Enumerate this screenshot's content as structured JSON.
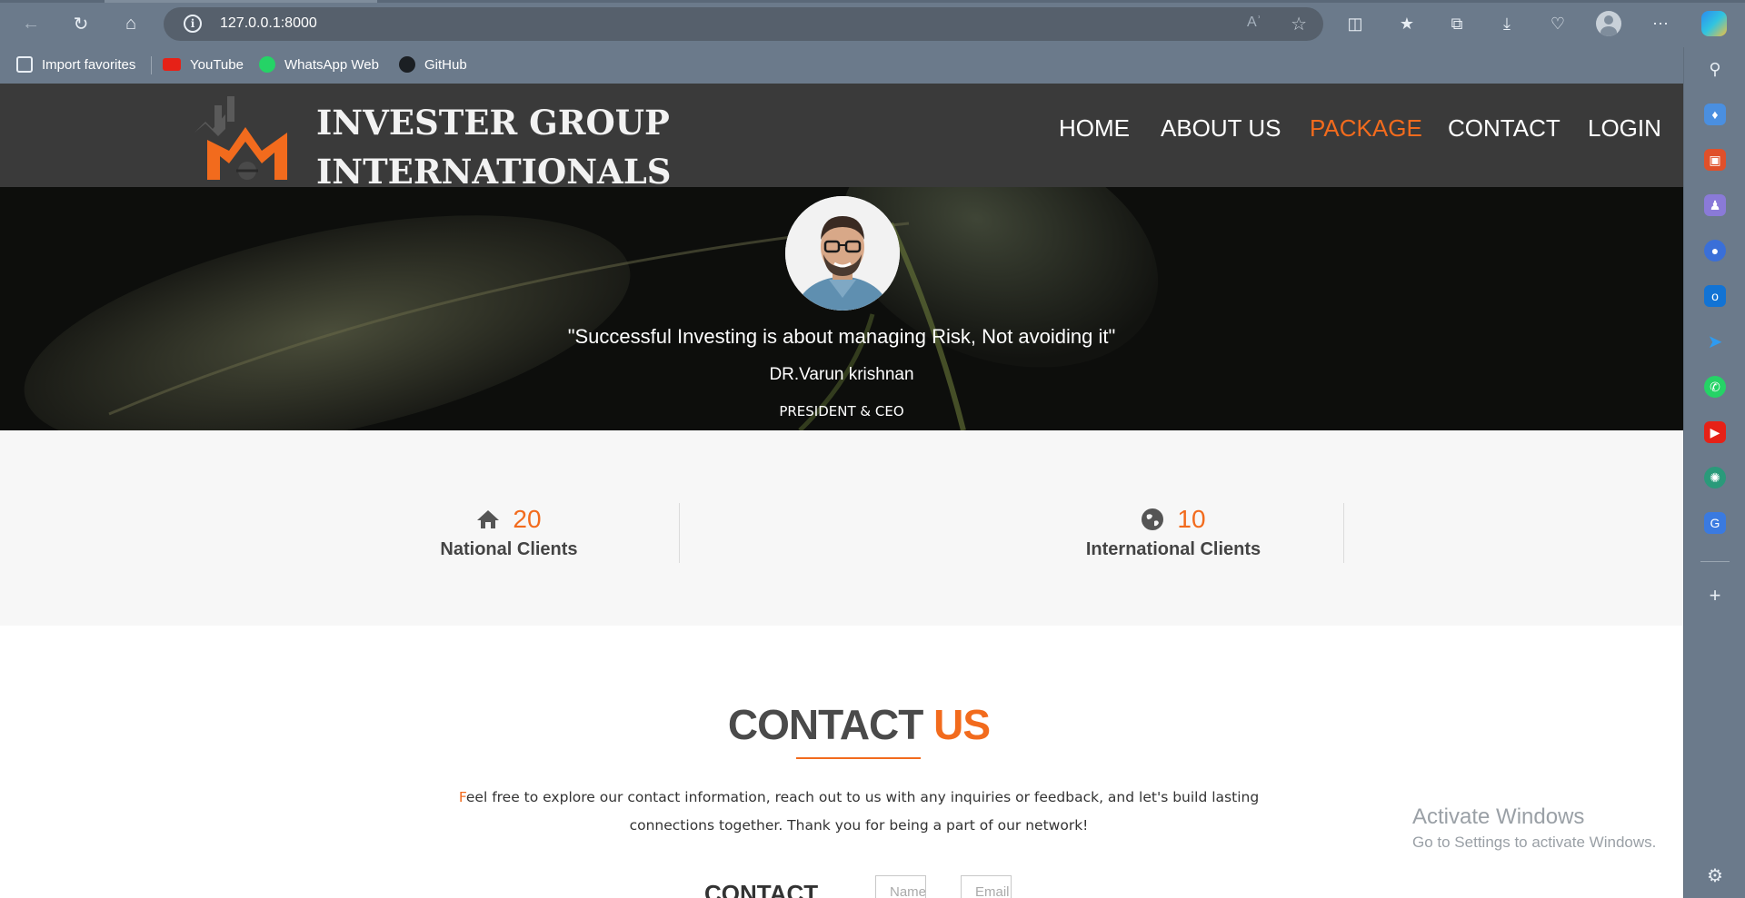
{
  "browser": {
    "url": "127.0.0.1:8000",
    "favorites": [
      {
        "label": "Import favorites"
      },
      {
        "label": "YouTube"
      },
      {
        "label": "WhatsApp Web"
      },
      {
        "label": "GitHub"
      }
    ]
  },
  "site": {
    "logo_line1": "INVESTER GROUP",
    "logo_line2": "INTERNATIONALS",
    "nav": [
      {
        "label": "HOME"
      },
      {
        "label": "ABOUT US"
      },
      {
        "label": "PACKAGE"
      },
      {
        "label": "CONTACT"
      },
      {
        "label": "LOGIN"
      }
    ],
    "active_nav": "PACKAGE",
    "accent_color": "#f26b1d"
  },
  "hero": {
    "quote": "\"Successful Investing is about managing Risk, Not avoiding it\"",
    "name": "DR.Varun krishnan",
    "role": "PRESIDENT & CEO"
  },
  "stats": [
    {
      "icon": "home-icon",
      "value": "20",
      "label": "National Clients"
    },
    {
      "icon": "globe-icon",
      "value": "10",
      "label": "International Clients"
    }
  ],
  "contact": {
    "title_main": "CONTACT",
    "title_accent": "US",
    "text_first_letter": "F",
    "text_rest": "eel free to explore our contact information, reach out to us with any inquiries or feedback, and let's build lasting connections together. Thank you for being a part of our network!",
    "subheading": "CONTACT",
    "name_placeholder": "Name",
    "email_placeholder": "Email"
  },
  "watermark": {
    "line1": "Activate Windows",
    "line2": "Go to Settings to activate Windows."
  }
}
